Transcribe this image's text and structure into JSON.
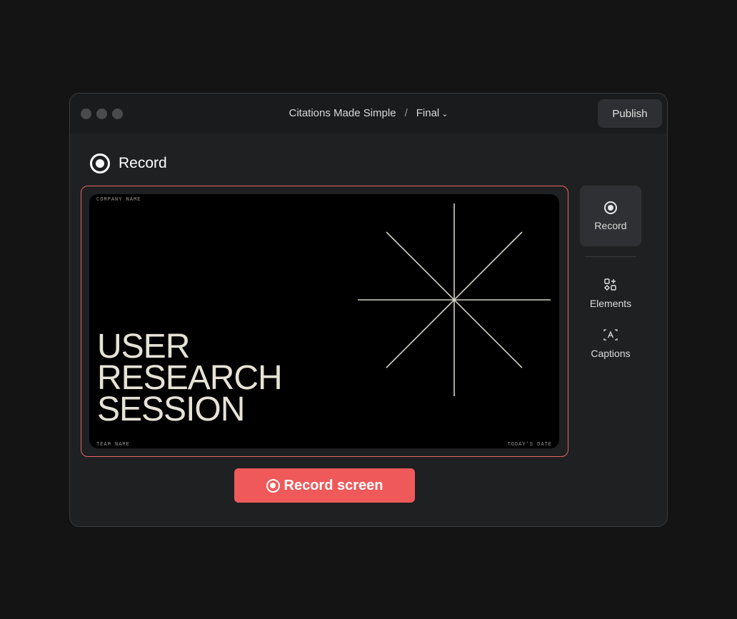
{
  "titlebar": {
    "project": "Citations Made Simple",
    "separator": "/",
    "version": "Final",
    "publish_label": "Publish"
  },
  "heading": {
    "label": "Record"
  },
  "slide": {
    "company": "COMPANY NAME",
    "headline_lines": [
      "USER",
      "RESEARCH",
      "SESSION"
    ],
    "team": "TEAM NAME",
    "date": "TODAY'S DATE"
  },
  "sidebar": {
    "items": [
      {
        "label": "Record",
        "icon": "record-icon",
        "active": true
      },
      {
        "label": "Elements",
        "icon": "elements-icon",
        "active": false
      },
      {
        "label": "Captions",
        "icon": "captions-icon",
        "active": false
      }
    ]
  },
  "record_button": {
    "label": "Record screen"
  },
  "colors": {
    "accent": "#f0595a",
    "window_bg": "#1f2022",
    "slide_text": "#e6e3d6"
  }
}
